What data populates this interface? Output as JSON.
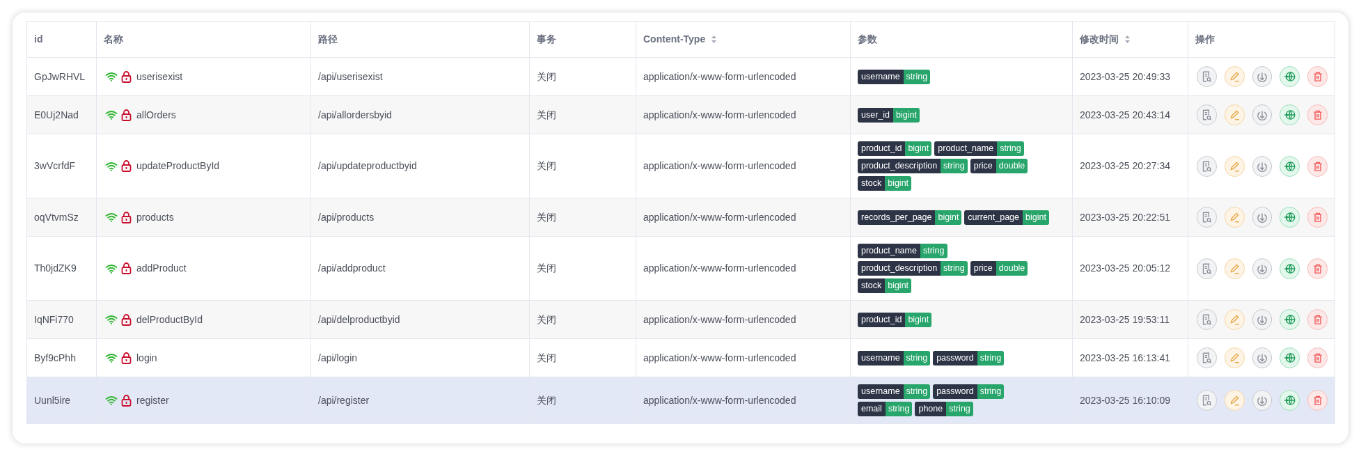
{
  "table": {
    "columns": [
      {
        "label": "id",
        "sortable": false
      },
      {
        "label": "名称",
        "sortable": false
      },
      {
        "label": "路径",
        "sortable": false
      },
      {
        "label": "事务",
        "sortable": false
      },
      {
        "label": "Content-Type",
        "sortable": true
      },
      {
        "label": "参数",
        "sortable": false
      },
      {
        "label": "修改时间",
        "sortable": true
      },
      {
        "label": "操作",
        "sortable": false
      }
    ],
    "rows": [
      {
        "id": "GpJwRHVL",
        "name": "userisexist",
        "path": "/api/userisexist",
        "transaction": "关闭",
        "content_type": "application/x-www-form-urlencoded",
        "params": [
          {
            "name": "username",
            "type": "string"
          }
        ],
        "modified": "2023-03-25 20:49:33",
        "hovered": false
      },
      {
        "id": "E0Uj2Nad",
        "name": "allOrders",
        "path": "/api/allordersbyid",
        "transaction": "关闭",
        "content_type": "application/x-www-form-urlencoded",
        "params": [
          {
            "name": "user_id",
            "type": "bigint"
          }
        ],
        "modified": "2023-03-25 20:43:14",
        "hovered": false
      },
      {
        "id": "3wVcrfdF",
        "name": "updateProductById",
        "path": "/api/updateproductbyid",
        "transaction": "关闭",
        "content_type": "application/x-www-form-urlencoded",
        "params": [
          {
            "name": "product_id",
            "type": "bigint"
          },
          {
            "name": "product_name",
            "type": "string"
          },
          {
            "name": "product_description",
            "type": "string"
          },
          {
            "name": "price",
            "type": "double"
          },
          {
            "name": "stock",
            "type": "bigint"
          }
        ],
        "modified": "2023-03-25 20:27:34",
        "hovered": false
      },
      {
        "id": "oqVtvmSz",
        "name": "products",
        "path": "/api/products",
        "transaction": "关闭",
        "content_type": "application/x-www-form-urlencoded",
        "params": [
          {
            "name": "records_per_page",
            "type": "bigint"
          },
          {
            "name": "current_page",
            "type": "bigint"
          }
        ],
        "modified": "2023-03-25 20:22:51",
        "hovered": false
      },
      {
        "id": "Th0jdZK9",
        "name": "addProduct",
        "path": "/api/addproduct",
        "transaction": "关闭",
        "content_type": "application/x-www-form-urlencoded",
        "params": [
          {
            "name": "product_name",
            "type": "string"
          },
          {
            "name": "product_description",
            "type": "string"
          },
          {
            "name": "price",
            "type": "double"
          },
          {
            "name": "stock",
            "type": "bigint"
          }
        ],
        "modified": "2023-03-25 20:05:12",
        "hovered": false
      },
      {
        "id": "IqNFi770",
        "name": "delProductById",
        "path": "/api/delproductbyid",
        "transaction": "关闭",
        "content_type": "application/x-www-form-urlencoded",
        "params": [
          {
            "name": "product_id",
            "type": "bigint"
          }
        ],
        "modified": "2023-03-25 19:53:11",
        "hovered": false
      },
      {
        "id": "Byf9cPhh",
        "name": "login",
        "path": "/api/login",
        "transaction": "关闭",
        "content_type": "application/x-www-form-urlencoded",
        "params": [
          {
            "name": "username",
            "type": "string"
          },
          {
            "name": "password",
            "type": "string"
          }
        ],
        "modified": "2023-03-25 16:13:41",
        "hovered": false
      },
      {
        "id": "Uunl5ire",
        "name": "register",
        "path": "/api/register",
        "transaction": "关闭",
        "content_type": "application/x-www-form-urlencoded",
        "params": [
          {
            "name": "username",
            "type": "string"
          },
          {
            "name": "password",
            "type": "string"
          },
          {
            "name": "email",
            "type": "string"
          },
          {
            "name": "phone",
            "type": "string"
          }
        ],
        "modified": "2023-03-25 16:10:09",
        "hovered": true
      }
    ]
  }
}
